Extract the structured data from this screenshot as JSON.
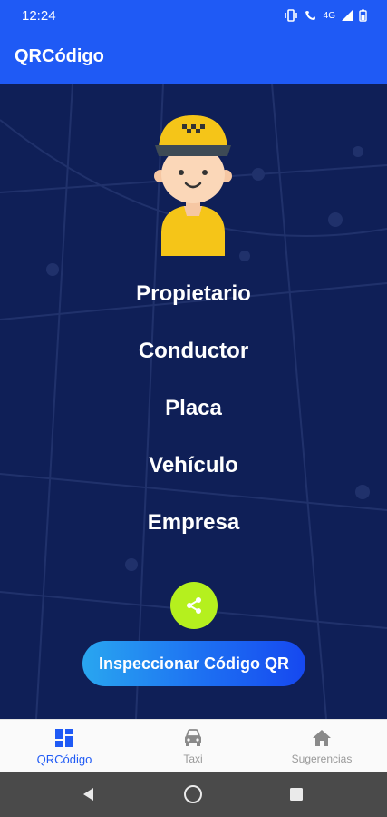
{
  "status_bar": {
    "time": "12:24",
    "network": "4G"
  },
  "app_bar": {
    "title": "QRCódigo"
  },
  "info": {
    "labels": [
      "Propietario",
      "Conductor",
      "Placa",
      "Vehículo",
      "Empresa"
    ]
  },
  "actions": {
    "inspect_label": "Inspeccionar Código QR"
  },
  "bottom_nav": {
    "items": [
      {
        "label": "QRCódigo",
        "icon": "dashboard-icon",
        "active": true
      },
      {
        "label": "Taxi",
        "icon": "car-icon",
        "active": false
      },
      {
        "label": "Sugerencias",
        "icon": "home-icon",
        "active": false
      }
    ]
  },
  "colors": {
    "primary": "#1f5af5",
    "background": "#0f1f57",
    "share_button": "#b5f01e",
    "nav_active": "#1f5af5",
    "nav_inactive": "#9a9a9a"
  }
}
